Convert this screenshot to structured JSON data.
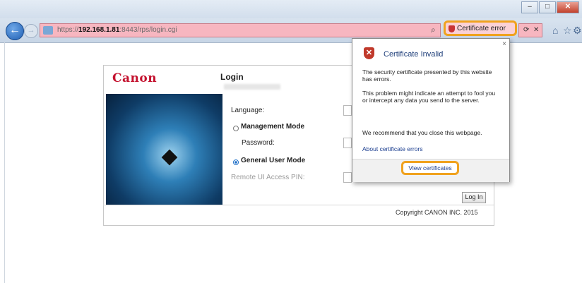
{
  "browser": {
    "window_buttons": {
      "minimize": "–",
      "maximize": "□",
      "close": "✕"
    },
    "nav": {
      "back": "←",
      "forward": "→"
    },
    "address": {
      "url_prefix": "https://",
      "url_host": "192.168.1.81",
      "url_rest": ":8443/rps/login.cgi"
    },
    "search_glyph": "⌕",
    "cert_error_label": "Certificate error",
    "tail_glyphs": [
      "⟳",
      "✕"
    ],
    "toolbar_icons": [
      "home-icon",
      "star-icon",
      "gear-icon"
    ],
    "toolbar_glyphs": {
      "home": "⌂",
      "star": "☆",
      "gear": "⚙"
    }
  },
  "page": {
    "logo": "Canon",
    "login_title": "Login",
    "form": {
      "language_label": "Language:",
      "management_mode_label": "Management Mode",
      "password_label": "Password:",
      "general_user_mode_label": "General User Mode",
      "remote_pin_label": "Remote UI Access PIN:",
      "selected_mode": "General User Mode"
    },
    "login_button": "Log In",
    "copyright": "Copyright CANON INC. 2015"
  },
  "popup": {
    "close": "×",
    "title": "Certificate Invalid",
    "text1": "The security certificate presented by this website has errors.",
    "text2": "This problem might indicate an attempt to fool you or intercept any data you send to the server.",
    "text3": "We recommend that you close this webpage.",
    "link": "About certificate errors",
    "button": "View certificates"
  },
  "colors": {
    "accent_highlight": "#f0a21f",
    "canon_red": "#c4122f",
    "address_error_pink": "#f7b6c0"
  }
}
